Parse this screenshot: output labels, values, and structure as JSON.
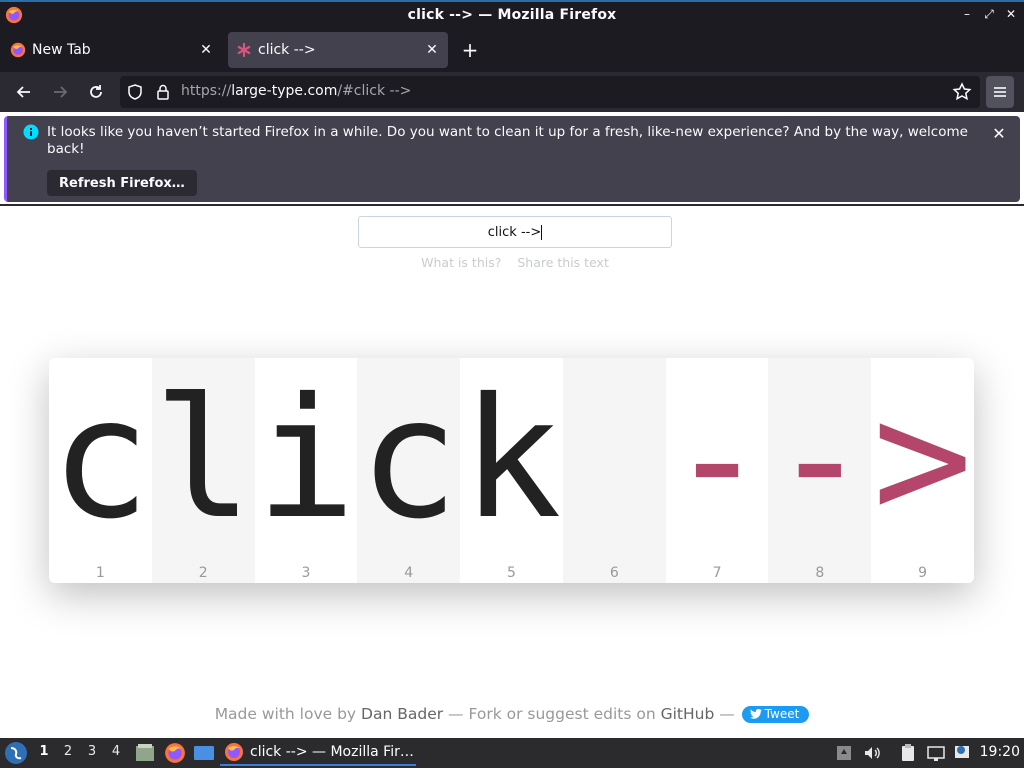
{
  "window": {
    "title": "click --> — Mozilla Firefox",
    "controls": [
      "–",
      "⤢",
      "✕"
    ]
  },
  "tabs": [
    {
      "label": "New Tab",
      "active": false,
      "icon": "firefox-icon"
    },
    {
      "label": "click -->",
      "active": true,
      "icon": "asterisk-icon"
    }
  ],
  "navbar": {
    "url_proto": "https://",
    "url_host": "large-type.com",
    "url_rest": "/#click -->"
  },
  "notification": {
    "message": "It looks like you haven’t started Firefox in a while. Do you want to clean it up for a fresh, like-new experience? And by the way, welcome back!",
    "button_label": "Refresh Firefox…"
  },
  "page": {
    "input_value": "click -->",
    "links": [
      "What is this?",
      "Share this text"
    ],
    "characters": [
      {
        "char": "c",
        "index": "1",
        "symbol": false
      },
      {
        "char": "l",
        "index": "2",
        "symbol": false
      },
      {
        "char": "i",
        "index": "3",
        "symbol": false
      },
      {
        "char": "c",
        "index": "4",
        "symbol": false
      },
      {
        "char": "k",
        "index": "5",
        "symbol": false
      },
      {
        "char": " ",
        "index": "6",
        "symbol": false
      },
      {
        "char": "-",
        "index": "7",
        "symbol": true
      },
      {
        "char": "-",
        "index": "8",
        "symbol": true
      },
      {
        "char": ">",
        "index": "9",
        "symbol": true
      }
    ],
    "footer": {
      "prefix": "Made with love by ",
      "author": "Dan Bader",
      "middle": " — Fork or suggest edits on ",
      "github": "GitHub",
      "suffix": " — ",
      "tweet": "Tweet"
    }
  },
  "taskbar": {
    "workspaces": [
      "1",
      "2",
      "3",
      "4"
    ],
    "active_workspace": "1",
    "task_label": "click --> — Mozilla Fir…",
    "clock": "19:20"
  },
  "colors": {
    "accent_symbol": "#b5466b",
    "notice_accent": "#9059ff",
    "tweet_blue": "#1d9bf0"
  }
}
